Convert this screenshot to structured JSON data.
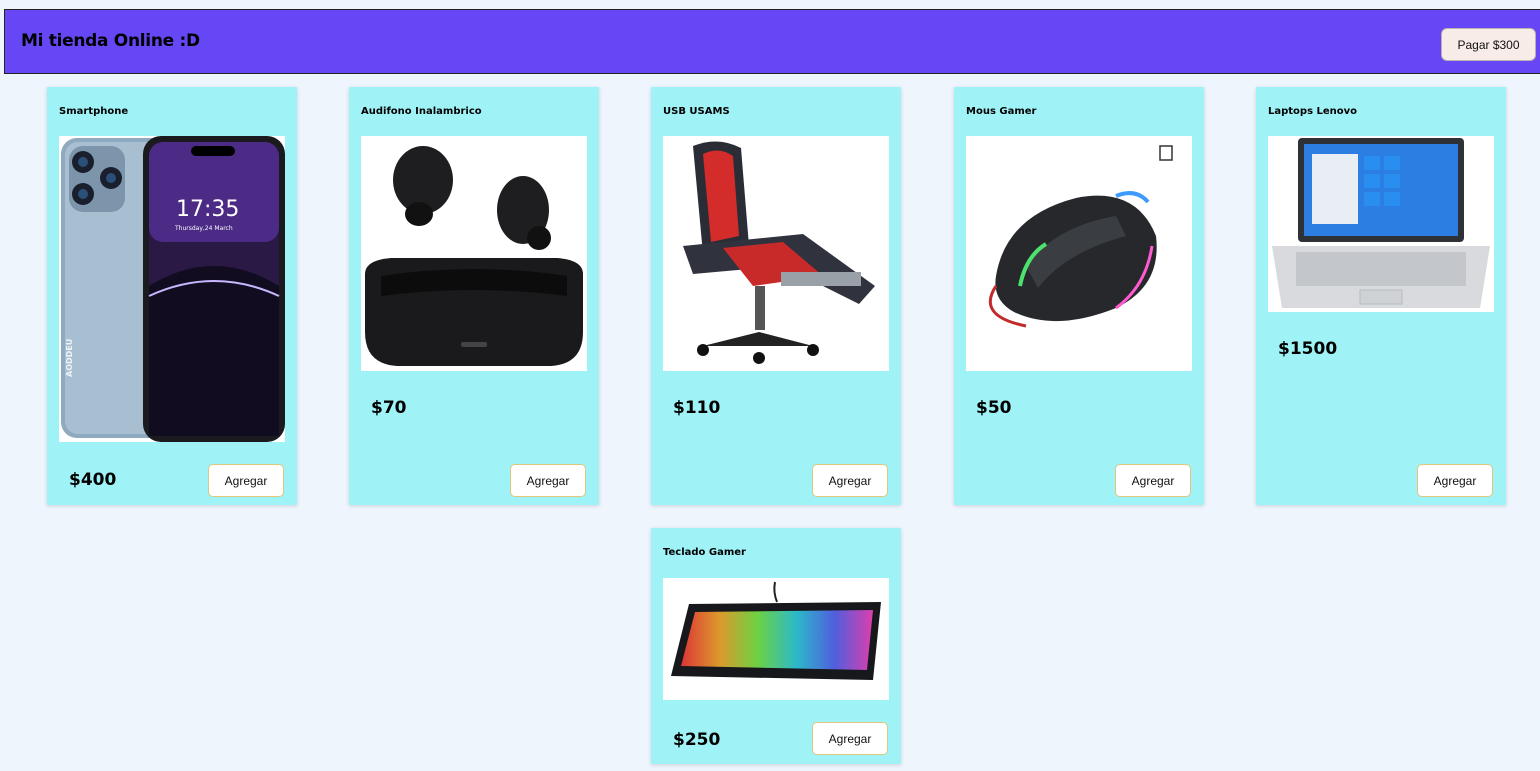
{
  "header": {
    "title": "Mi tienda Online :D",
    "pay_label": "Pagar $300"
  },
  "products": [
    {
      "name": "Smartphone",
      "price": "$400",
      "add_label": "Agregar",
      "image": "smartphone-photo",
      "screen_time": "17:35",
      "screen_date": "Thursday,24 March",
      "brand_mark": "AODDEU"
    },
    {
      "name": "Audifono Inalambrico",
      "price": "$70",
      "add_label": "Agregar",
      "image": "wireless-earbuds-photo"
    },
    {
      "name": "USB USAMS",
      "price": "$110",
      "add_label": "Agregar",
      "image": "gaming-chair-photo"
    },
    {
      "name": "Mous Gamer",
      "price": "$50",
      "add_label": "Agregar",
      "image": "gaming-mouse-photo"
    },
    {
      "name": "Laptops Lenovo",
      "price": "$1500",
      "add_label": "Agregar",
      "image": "laptop-photo"
    },
    {
      "name": "Teclado Gamer",
      "price": "$250",
      "add_label": "Agregar",
      "image": "gaming-keyboard-photo"
    }
  ],
  "colors": {
    "header_bg": "#6646f5",
    "card_bg": "#9ff3f7",
    "page_bg": "#eef5fd"
  }
}
